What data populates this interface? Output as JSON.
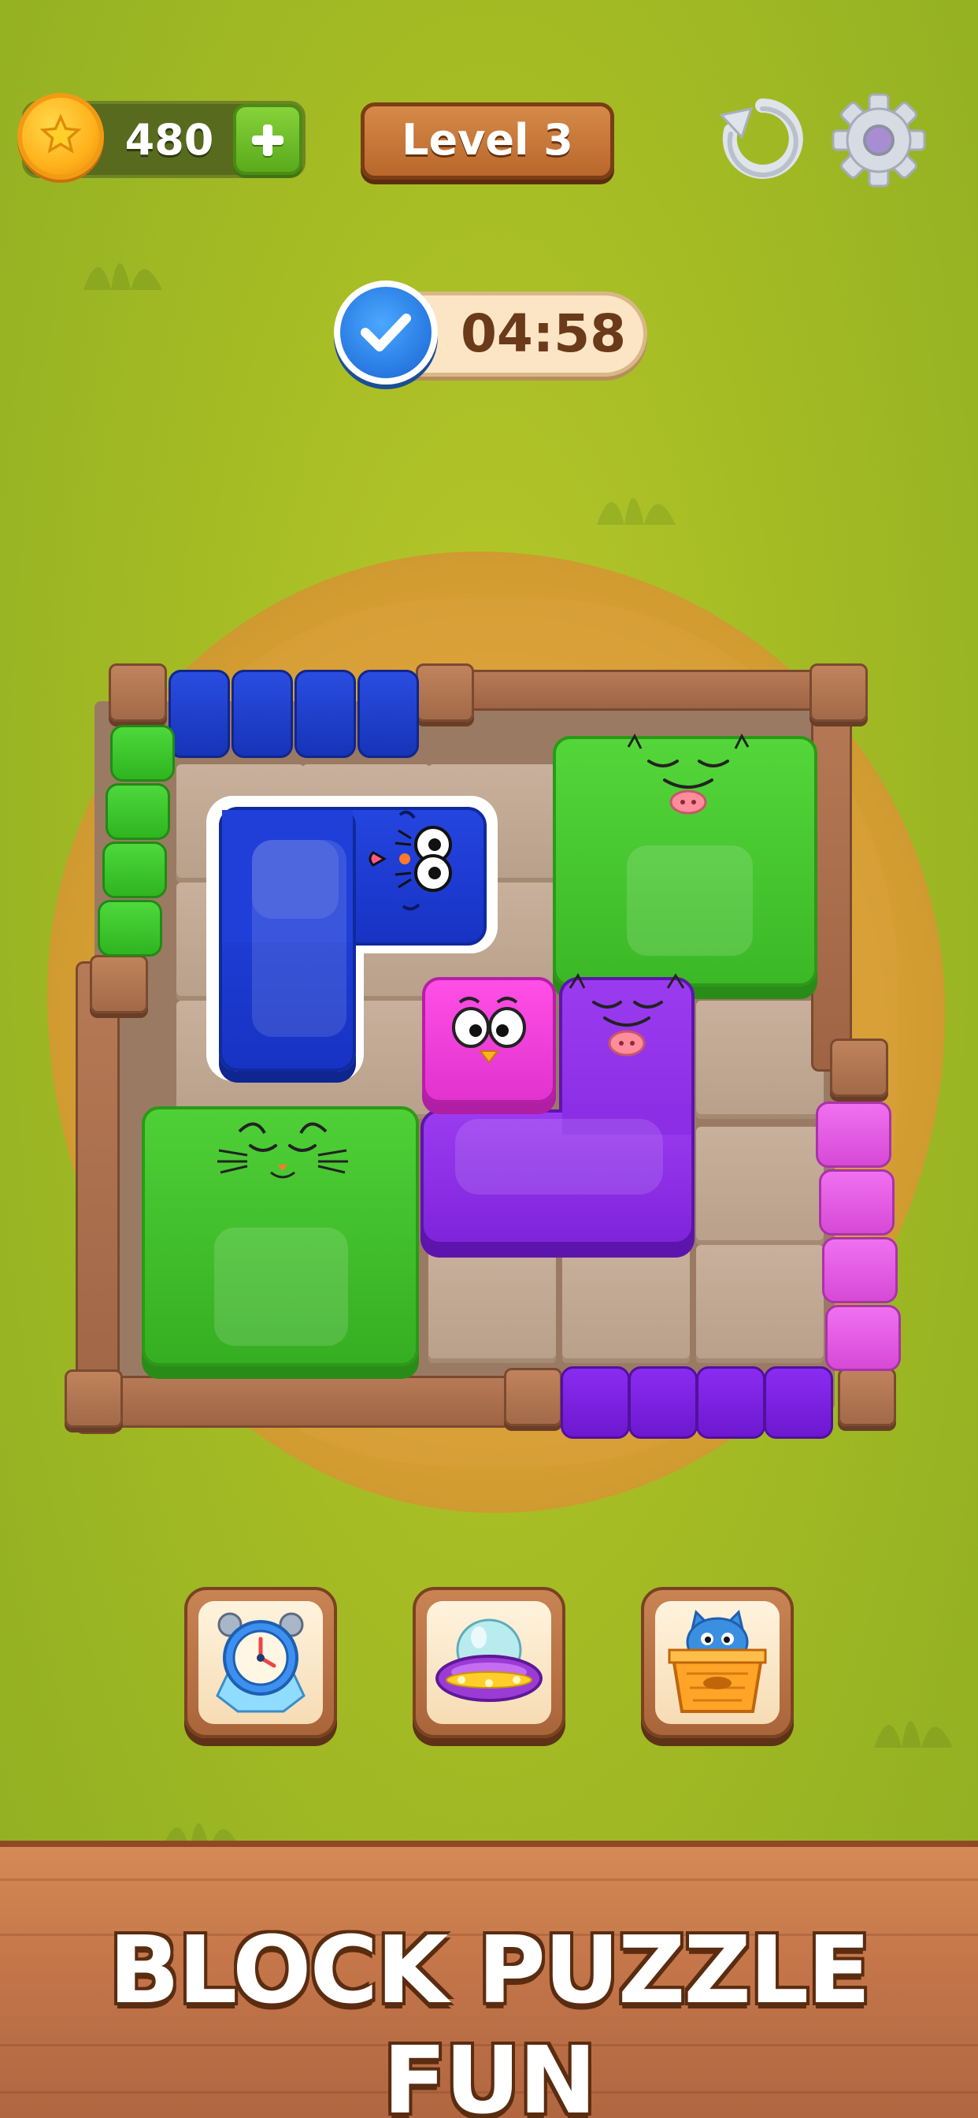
{
  "hud": {
    "coins": "480",
    "level_label": "Level 3",
    "coin_icon": "star-coin-icon",
    "add_icon": "plus-icon",
    "restart_icon": "restart-icon",
    "settings_icon": "gear-icon"
  },
  "timer": {
    "value": "04:58",
    "icon": "check-icon"
  },
  "board": {
    "blocks": [
      {
        "color": "blue",
        "shape": "L",
        "selected": true
      },
      {
        "color": "green",
        "shape": "square-2x2"
      },
      {
        "color": "green",
        "shape": "square-2x2"
      },
      {
        "color": "pink",
        "shape": "single"
      },
      {
        "color": "purple",
        "shape": "L"
      }
    ],
    "gates": [
      "blue",
      "green",
      "pink",
      "purple"
    ]
  },
  "boosters": [
    {
      "name": "freeze-time",
      "icon": "alarm-clock-icon"
    },
    {
      "name": "ufo",
      "icon": "ufo-icon"
    },
    {
      "name": "cat-basket",
      "icon": "cat-basket-icon"
    }
  ],
  "footer": {
    "title": "BLOCK PUZZLE FUN"
  },
  "colors": {
    "background": "#a4bb24",
    "wood": "#c5774a",
    "blue_block": "#1f3fd6",
    "green_block": "#3fbd28",
    "purple_block": "#8a2ee6",
    "pink_block": "#ee3fdc"
  }
}
